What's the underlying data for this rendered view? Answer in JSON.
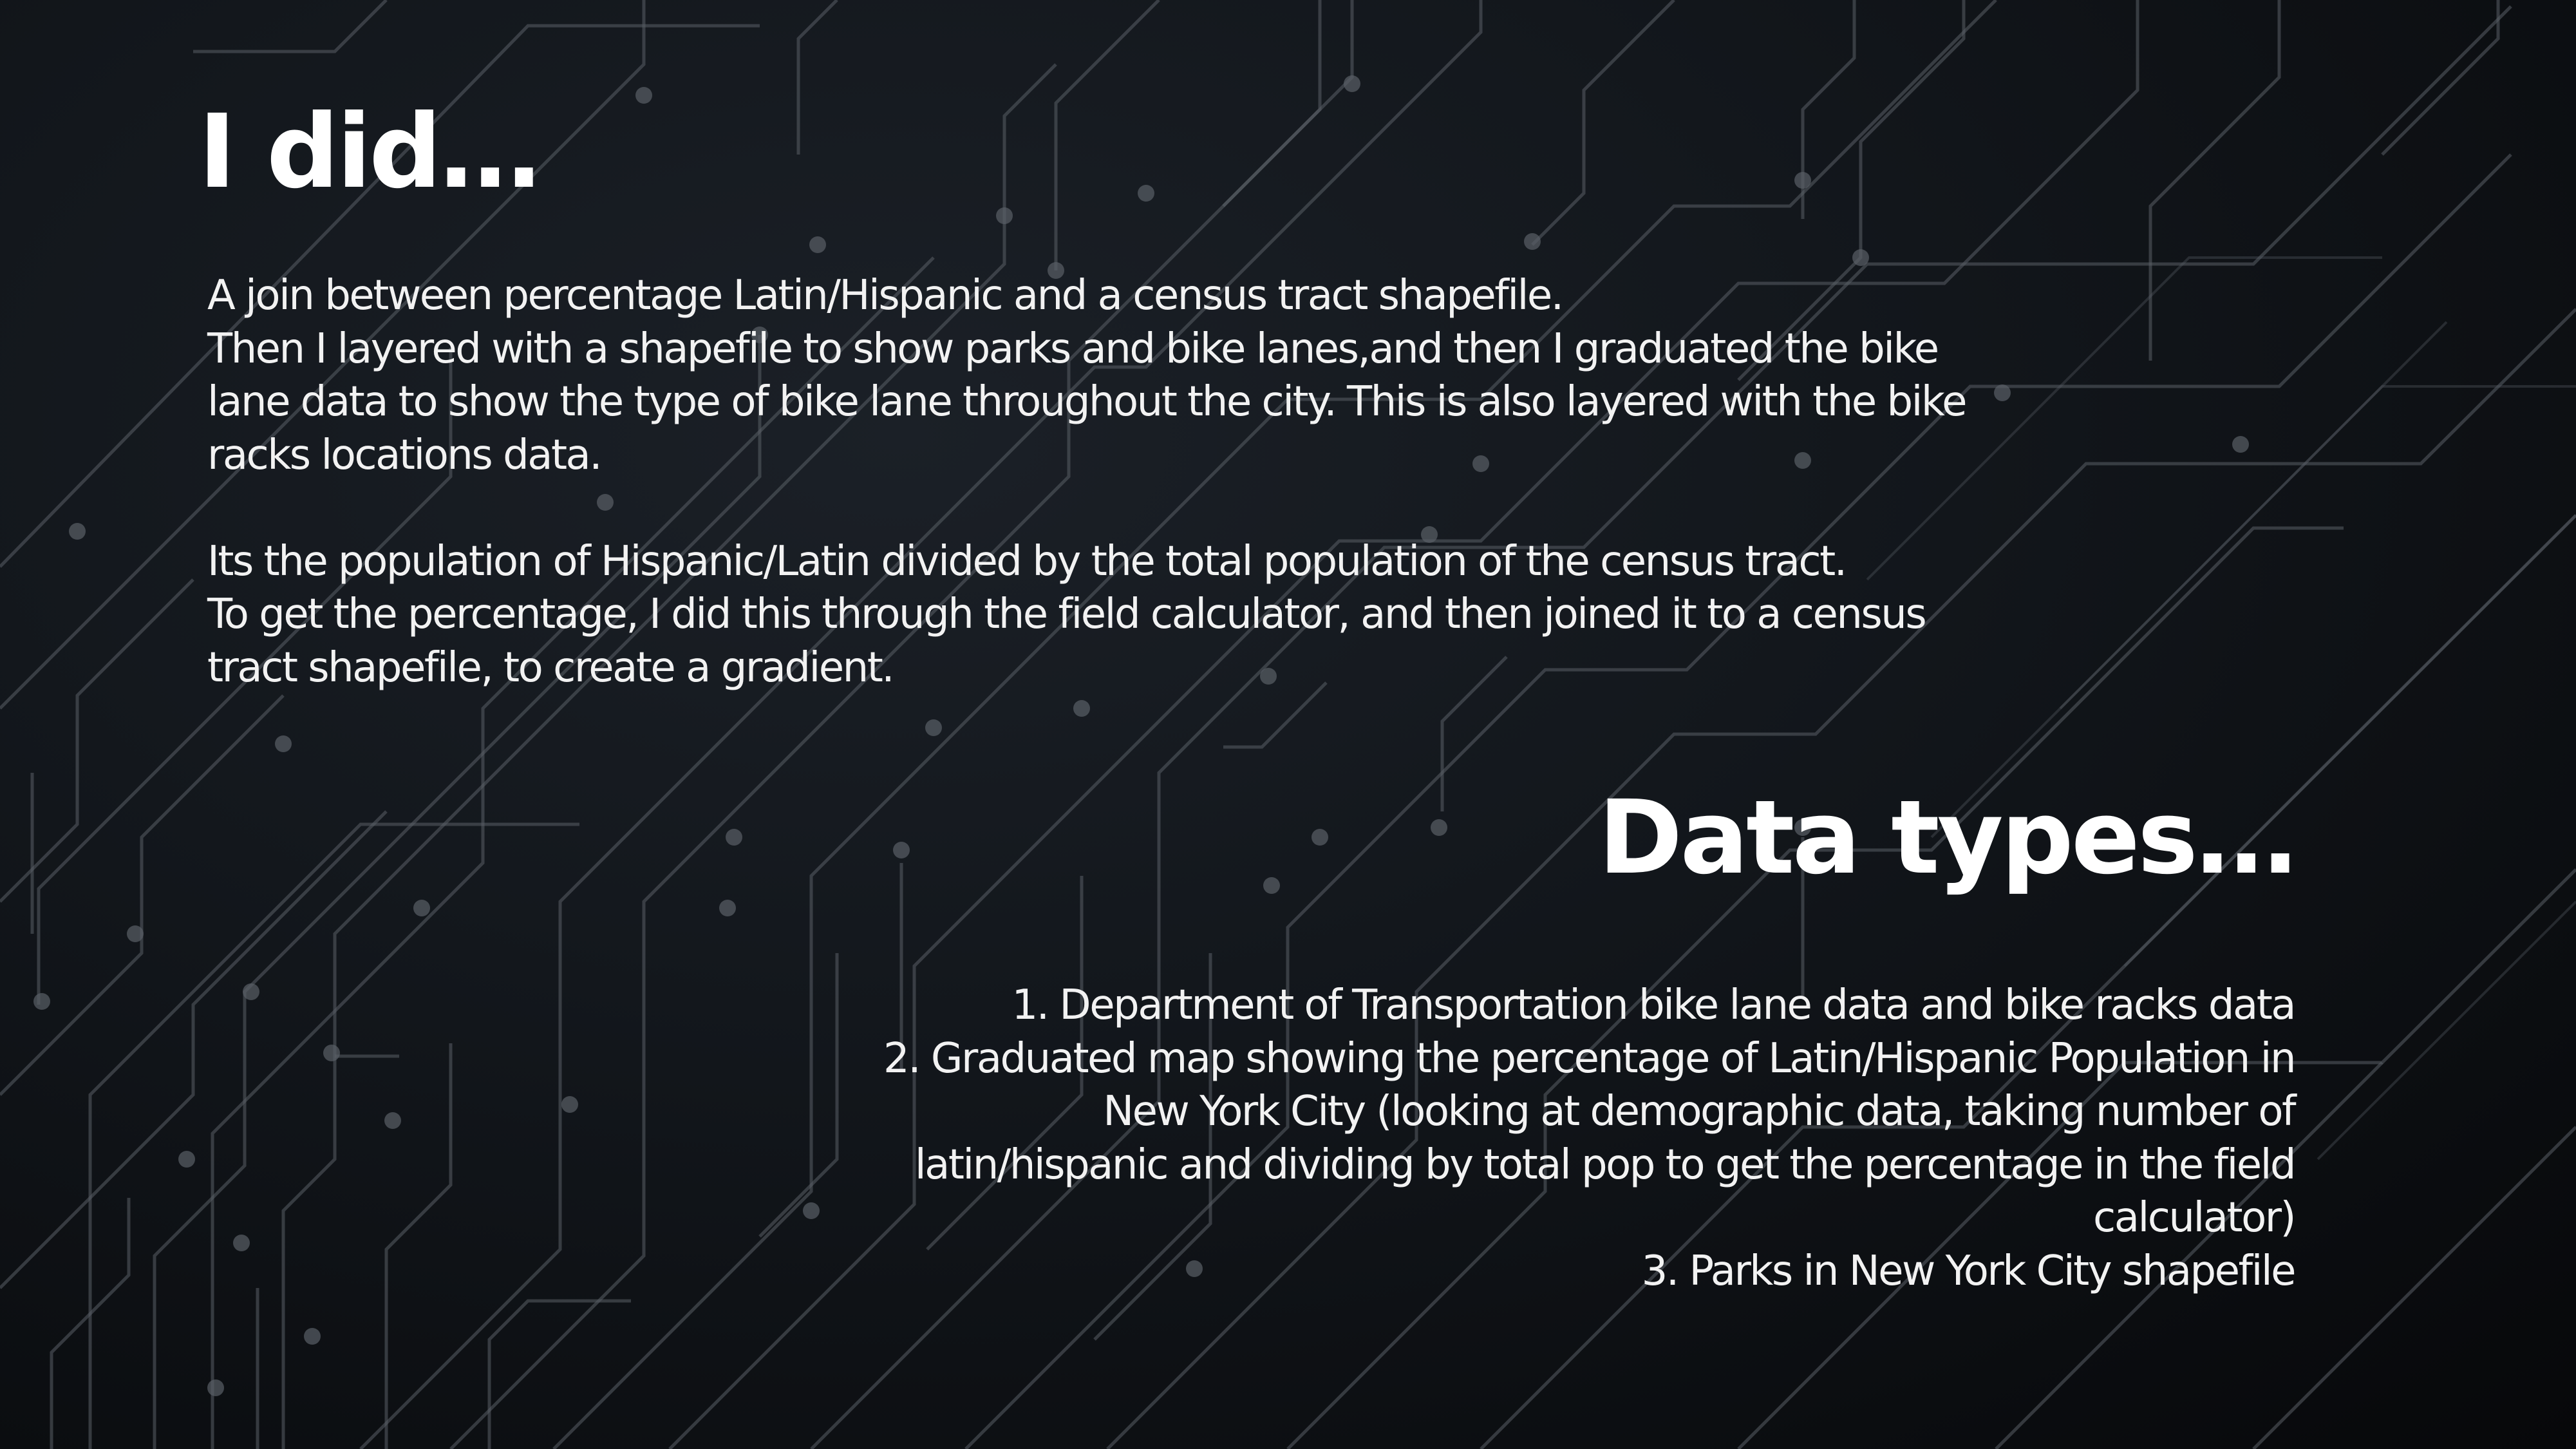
{
  "section_did": {
    "heading": "I did…",
    "lines": [
      "A join between percentage Latin/Hispanic and a census tract shapefile.",
      "Then I layered with a shapefile to show parks and bike lanes,and then I graduated the bike",
      "lane data to show the type of bike lane throughout the city. This is also layered with the bike",
      "racks locations data.",
      "",
      "Its the population of Hispanic/Latin divided by the total population of the census tract.",
      "To get the percentage, I did this through the field calculator,  and then joined it to a census",
      "tract shapefile, to create a gradient."
    ]
  },
  "section_data_types": {
    "heading": "Data types…",
    "items": [
      "1. Department of Transportation bike lane data and bike racks data",
      "2. Graduated map showing the percentage of Latin/Hispanic Population in New York City (looking at demographic data, taking number of latin/hispanic and dividing by total pop to get the percentage in the field calculator)",
      "3. Parks in New York City shapefile"
    ]
  },
  "colors": {
    "background": "#12161b",
    "text": "#ffffff",
    "circuit_lines": "#5a5f66"
  }
}
